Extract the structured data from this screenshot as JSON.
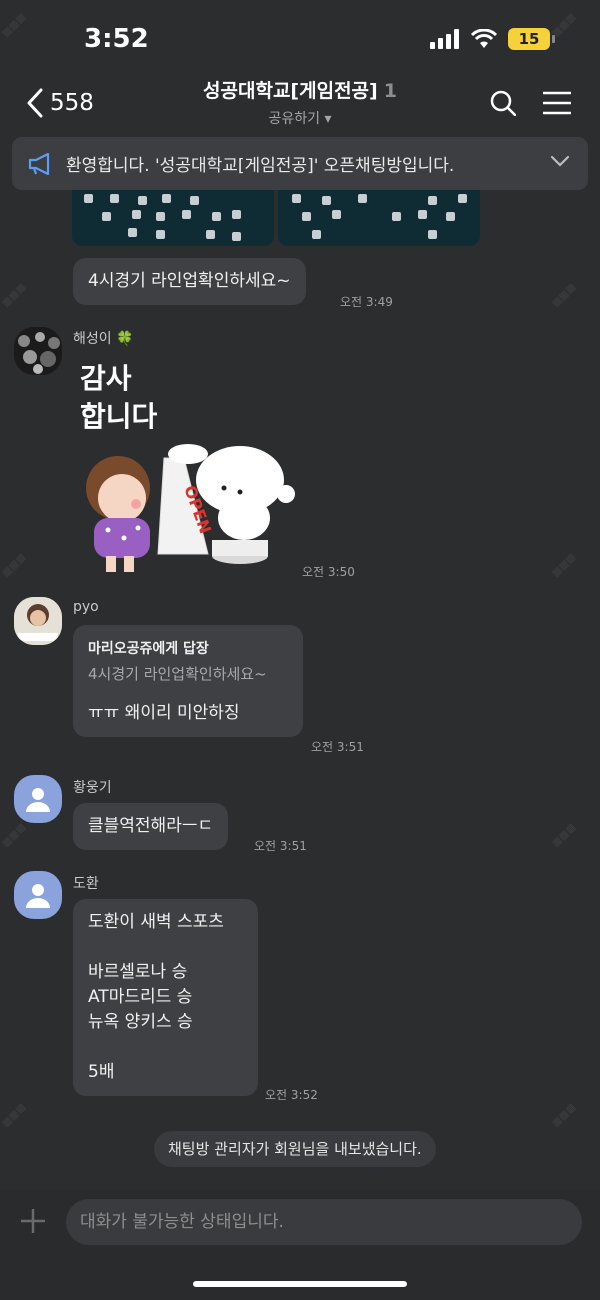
{
  "status": {
    "time": "3:52",
    "battery": "15"
  },
  "header": {
    "back_count": "558",
    "title": "성공대학교[게임전공]",
    "member_count": "1",
    "share_label": "공유하기"
  },
  "notice": {
    "text": "환영합니다. '성공대학교[게임전공]' 오픈채팅방입니다."
  },
  "messages": [
    {
      "text": "4시경기 라인업확인하세요~",
      "time": "오전 3:49"
    },
    {
      "sender": "해성이 🍀",
      "sticker_text_1": "감사",
      "sticker_text_2": "합니다",
      "sticker_sign": "OPEN",
      "time": "오전 3:50"
    },
    {
      "sender": "pyo",
      "reply_to": "마리오공쥬에게 답장",
      "reply_quote": "4시경기 라인업확인하세요~",
      "text": "ㅠㅠ 왜이리 미안하징",
      "time": "오전 3:51"
    },
    {
      "sender": "황웅기",
      "text": "클블역전해라ㅡㄷ",
      "time": "오전 3:51"
    },
    {
      "sender": "도환",
      "lines": [
        "도환이 새벽 스포츠",
        "",
        "바르셀로나 승",
        "AT마드리드 승",
        "뉴옥 양키스 승",
        "",
        "5배"
      ],
      "time": "오전 3:52"
    }
  ],
  "system": {
    "text": "채팅방 관리자가 회원님을 내보냈습니다."
  },
  "input": {
    "placeholder": "대화가 불가능한 상태입니다."
  }
}
